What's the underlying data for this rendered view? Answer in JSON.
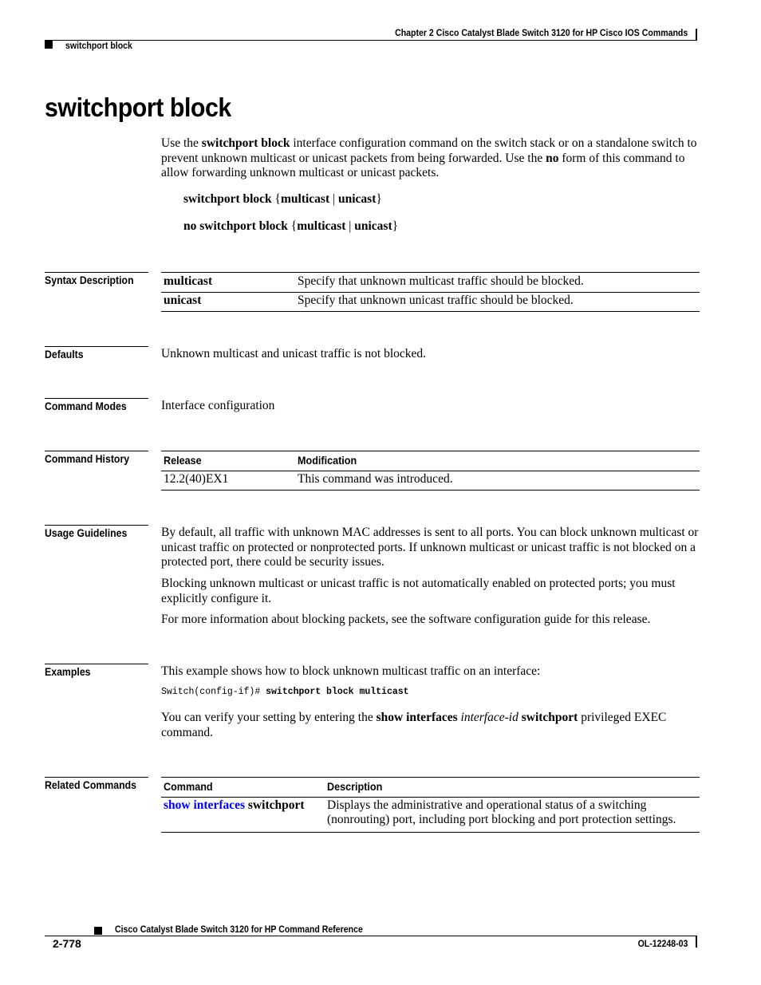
{
  "header": {
    "chapter": "Chapter  2 Cisco Catalyst Blade Switch 3120 for HP Cisco IOS Commands",
    "section": "switchport block"
  },
  "title": "switchport block",
  "intro": {
    "p1": "Use the ",
    "p1_bold": "switchport block",
    "p2": " interface configuration command on the switch stack or on a standalone switch to prevent unknown multicast or unicast packets from being forwarded. Use the ",
    "p2_bold": "no",
    "p3": " form of this command to allow forwarding unknown multicast or unicast packets."
  },
  "syntax": [
    {
      "cmd": "switchport block",
      "open": " {",
      "arg1": "multicast",
      "sep": " | ",
      "arg2": "unicast",
      "close": "}"
    },
    {
      "cmd": "no switchport block",
      "open": " {",
      "arg1": "multicast",
      "sep": " | ",
      "arg2": "unicast",
      "close": "}"
    }
  ],
  "sections": {
    "syntax_description": "Syntax Description",
    "defaults": "Defaults",
    "command_modes": "Command Modes",
    "command_history": "Command History",
    "usage_guidelines": "Usage Guidelines",
    "examples": "Examples",
    "related_commands": "Related Commands"
  },
  "syntax_description": [
    {
      "keyword": "multicast",
      "description": "Specify that unknown multicast traffic should be blocked."
    },
    {
      "keyword": "unicast",
      "description": "Specify that unknown unicast traffic should be blocked."
    }
  ],
  "defaults": "Unknown multicast and unicast traffic is not blocked.",
  "command_modes": "Interface configuration",
  "command_history": {
    "headers": [
      "Release",
      "Modification"
    ],
    "rows": [
      {
        "release": "12.2(40)EX1",
        "modification": "This command was introduced."
      }
    ]
  },
  "usage_guidelines": [
    "By default, all traffic with unknown MAC addresses is sent to all ports. You can block unknown multicast or unicast traffic on protected or nonprotected ports. If unknown multicast or unicast traffic is not blocked on a protected port, there could be security issues.",
    "Blocking unknown multicast or unicast traffic is not automatically enabled on protected ports; you must explicitly configure it.",
    "For more information about blocking packets, see the software configuration guide for this release."
  ],
  "examples": {
    "intro": "This example shows how to block unknown multicast traffic on an interface:",
    "prompt": "Switch(config-if)# ",
    "command": "switchport block multicast",
    "verify_pre": "You can verify your setting by entering the ",
    "verify_bold1": "show interfaces",
    "verify_italic": " interface-id ",
    "verify_bold2": "switchport",
    "verify_post": " privileged EXEC command."
  },
  "related_commands": {
    "headers": [
      "Command",
      "Description"
    ],
    "rows": [
      {
        "command_link": "show interfaces",
        "command_rest": " switchport",
        "description": "Displays the administrative and operational status of a switching (nonrouting) port, including port blocking and port protection settings."
      }
    ]
  },
  "colors": {
    "link": "#0000ee"
  },
  "footer": {
    "book_title": "Cisco Catalyst Blade Switch 3120 for HP Command Reference",
    "page_number": "2-778",
    "doc_number": "OL-12248-03"
  }
}
